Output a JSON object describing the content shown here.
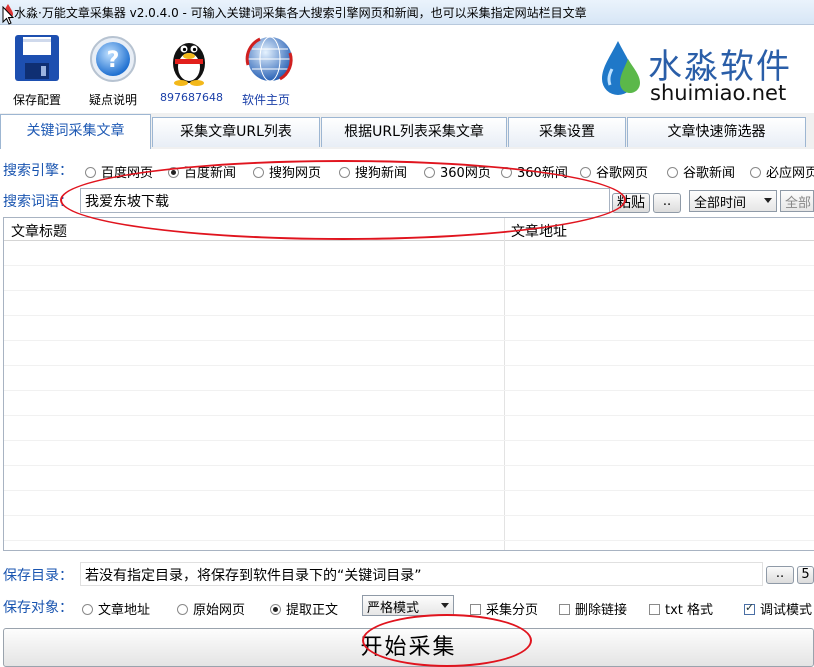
{
  "window": {
    "title": "水淼·万能文章采集器 v2.0.4.0 - 可输入关键词采集各大搜索引擎网页和新闻，也可以采集指定网站栏目文章"
  },
  "toolbar": {
    "items": [
      {
        "label": "保存配置",
        "icon": "floppy-disk-icon"
      },
      {
        "label": "疑点说明",
        "icon": "help-icon"
      },
      {
        "label": "897687648",
        "icon": "qq-penguin-icon"
      },
      {
        "label": "软件主页",
        "icon": "globe-icon"
      }
    ],
    "logo": {
      "cn": "水淼软件",
      "en": "shuimiao.net"
    }
  },
  "tabs": [
    {
      "label": "关键词采集文章",
      "active": true
    },
    {
      "label": "采集文章URL列表",
      "active": false
    },
    {
      "label": "根据URL列表采集文章",
      "active": false
    },
    {
      "label": "采集设置",
      "active": false
    },
    {
      "label": "文章快速筛选器",
      "active": false
    }
  ],
  "engine": {
    "label": "搜索引擎：",
    "options": [
      {
        "label": "百度网页",
        "selected": false
      },
      {
        "label": "百度新闻",
        "selected": true
      },
      {
        "label": "搜狗网页",
        "selected": false
      },
      {
        "label": "搜狗新闻",
        "selected": false
      },
      {
        "label": "360网页",
        "selected": false
      },
      {
        "label": "360新闻",
        "selected": false
      },
      {
        "label": "谷歌网页",
        "selected": false
      },
      {
        "label": "谷歌新闻",
        "selected": false
      },
      {
        "label": "必应网页",
        "selected": false
      }
    ]
  },
  "keyword": {
    "label": "搜索词语：",
    "value": "我爱东坡下载",
    "paste_label": "粘贴",
    "browse_label": "..",
    "time_select": "全部时间",
    "scope_select": "全部"
  },
  "table": {
    "col_title": "文章标题",
    "col_url": "文章地址"
  },
  "save_dir": {
    "label": "保存目录：",
    "value": "若没有指定目录，将保存到软件目录下的“关键词目录”",
    "browse_label": "..",
    "extra_label": "5"
  },
  "save_target": {
    "label": "保存对象：",
    "radios": [
      {
        "label": "文章地址",
        "selected": false
      },
      {
        "label": "原始网页",
        "selected": false
      },
      {
        "label": "提取正文",
        "selected": true
      }
    ],
    "mode_select": "严格模式",
    "checks": [
      {
        "label": "采集分页",
        "checked": false
      },
      {
        "label": "删除链接",
        "checked": false
      },
      {
        "label": "txt 格式",
        "checked": false
      },
      {
        "label": "调试模式",
        "checked": true
      }
    ]
  },
  "start_button": "开始采集",
  "colors": {
    "accent": "#1f5ab4",
    "annotation": "#e0141e"
  }
}
